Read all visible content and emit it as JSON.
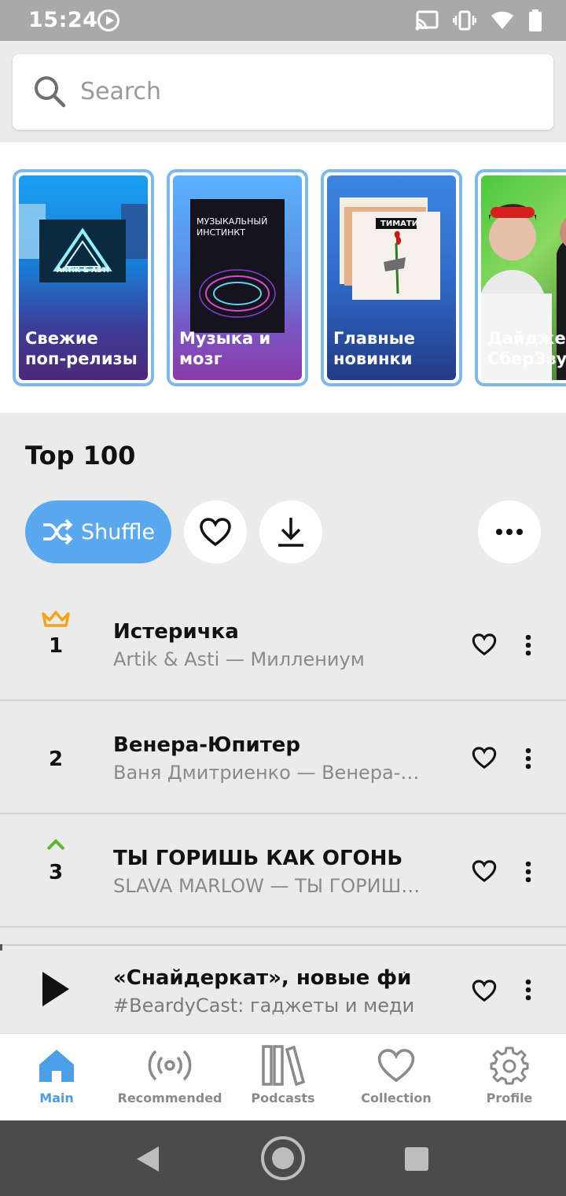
{
  "status_bar": {
    "time": "15:24",
    "icons": [
      "play-icon",
      "cast-icon",
      "vibrate-icon",
      "wifi-icon",
      "battery-icon"
    ]
  },
  "search": {
    "placeholder": "Search",
    "value": ""
  },
  "carousel": {
    "cards": [
      {
        "label": "Свежие\nпоп-релизы",
        "cover_text": "ARTIK & ASTI"
      },
      {
        "label": "Музыка и\nмозг",
        "cover_text": "МУЗЫКАЛЬНЫЙ ИНСТИНКТ"
      },
      {
        "label": "Главные\nновинки",
        "cover_text": "ТИМАТИ"
      },
      {
        "label": "Дайджест\nСберЗвук",
        "cover_text": ""
      }
    ]
  },
  "top": {
    "title": "Top 100",
    "shuffle_label": "Shuffle"
  },
  "tracks": [
    {
      "rank": "1",
      "title": "Истеричка",
      "subtitle": "Artik & Asti — Миллениум",
      "badge": "crown-icon"
    },
    {
      "rank": "2",
      "title": "Венера-Юпитер",
      "subtitle": "Ваня Дмитриенко — Венера-Юпитер",
      "badge": ""
    },
    {
      "rank": "3",
      "title": "ТЫ ГОРИШЬ КАК ОГОНЬ",
      "subtitle": "SLAVA MARLOW — ТЫ ГОРИШЬ КАК ОГОНЬ",
      "badge": "chevron-up-icon"
    }
  ],
  "player": {
    "title": "«Снайдеркат», новые фи",
    "subtitle": "#BeardyCast: гаджеты и меди",
    "dots": "· ·"
  },
  "bottom_nav": {
    "items": [
      {
        "label": "Main",
        "icon": "home-icon",
        "active": true
      },
      {
        "label": "Recommended",
        "icon": "broadcast-icon",
        "active": false
      },
      {
        "label": "Podcasts",
        "icon": "library-icon",
        "active": false
      },
      {
        "label": "Collection",
        "icon": "heart-icon",
        "active": false
      },
      {
        "label": "Profile",
        "icon": "gear-icon",
        "active": false
      }
    ]
  },
  "colors": {
    "accent": "#5aa9f0",
    "active_nav": "#4a9fe6",
    "crown": "#f2a51a",
    "trend_up": "#5cb82c"
  }
}
